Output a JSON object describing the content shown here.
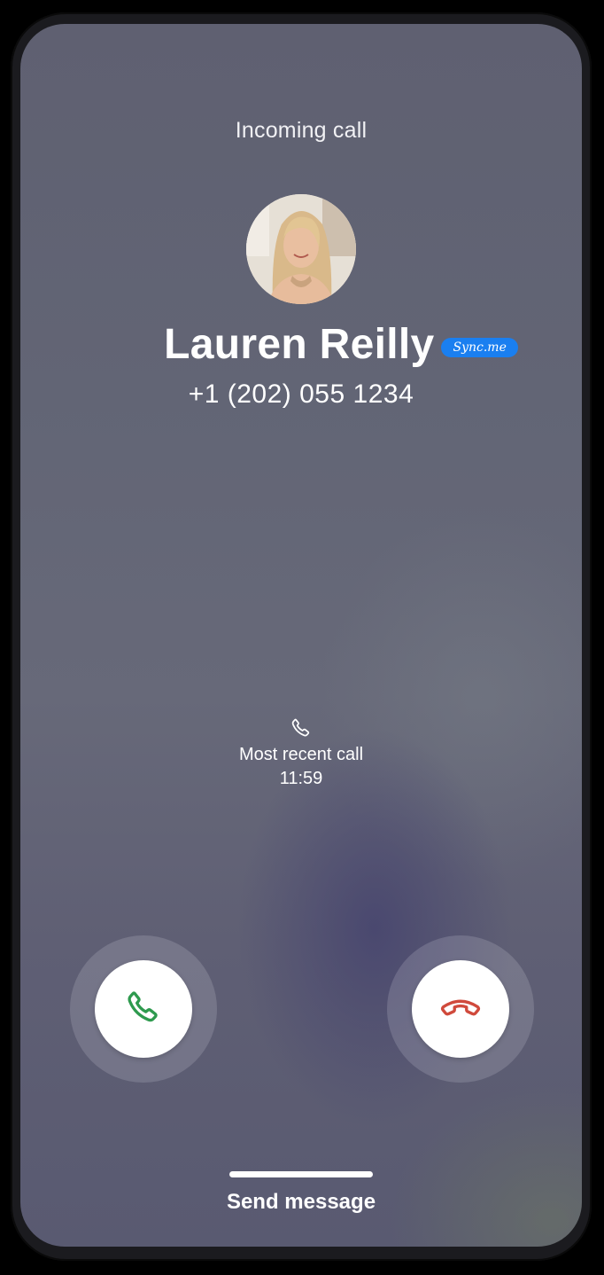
{
  "header": {
    "status_label": "Incoming call"
  },
  "caller": {
    "name": "Lauren Reilly",
    "badge": "Sync.me",
    "number": "+1 (202) 055 1234"
  },
  "recent": {
    "icon": "phone-icon",
    "label": "Most recent call",
    "time": "11:59"
  },
  "actions": {
    "accept_icon": "phone-accept-icon",
    "decline_icon": "phone-decline-icon",
    "accept_color": "#2e9a4e",
    "decline_color": "#d04a3c"
  },
  "footer": {
    "send_message_label": "Send message"
  },
  "colors": {
    "badge_bg": "#1a7ff0",
    "text": "#ffffff"
  }
}
